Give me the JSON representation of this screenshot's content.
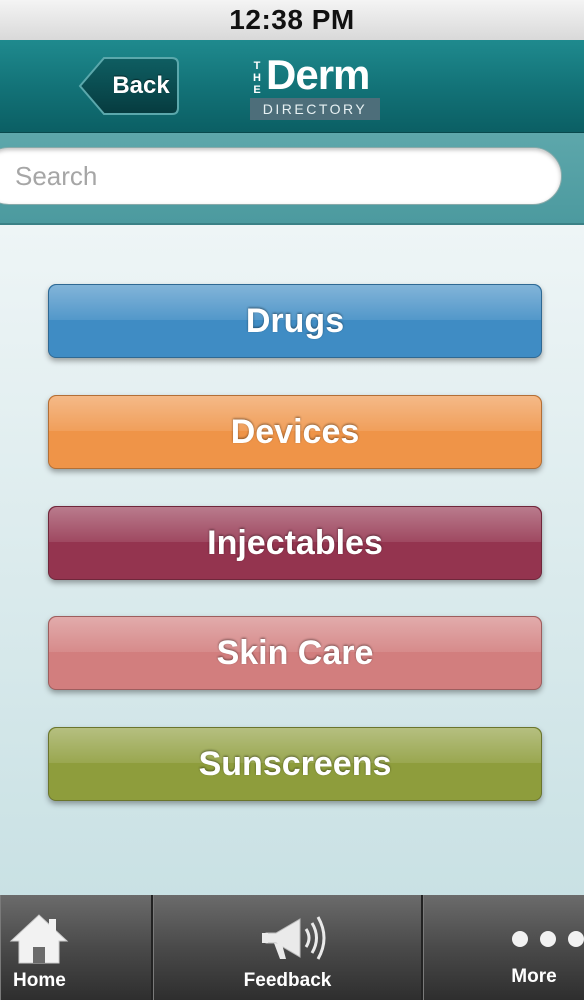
{
  "status_bar": {
    "time": "12:38 PM"
  },
  "nav": {
    "back_label": "Back",
    "logo": {
      "the": "THE",
      "derm": "Derm",
      "directory": "DIRECTORY"
    }
  },
  "search": {
    "placeholder": "Search",
    "value": ""
  },
  "categories": [
    {
      "label": "Drugs",
      "color": "#3f8cc4"
    },
    {
      "label": "Devices",
      "color": "#ef9448"
    },
    {
      "label": "Injectables",
      "color": "#94344f"
    },
    {
      "label": "Skin Care",
      "color": "#d27e7e"
    },
    {
      "label": "Sunscreens",
      "color": "#8e9d3c"
    }
  ],
  "tabs": [
    {
      "label": "Home",
      "icon": "home-icon"
    },
    {
      "label": "Feedback",
      "icon": "megaphone-icon"
    },
    {
      "label": "More",
      "icon": "more-dots-icon"
    }
  ]
}
